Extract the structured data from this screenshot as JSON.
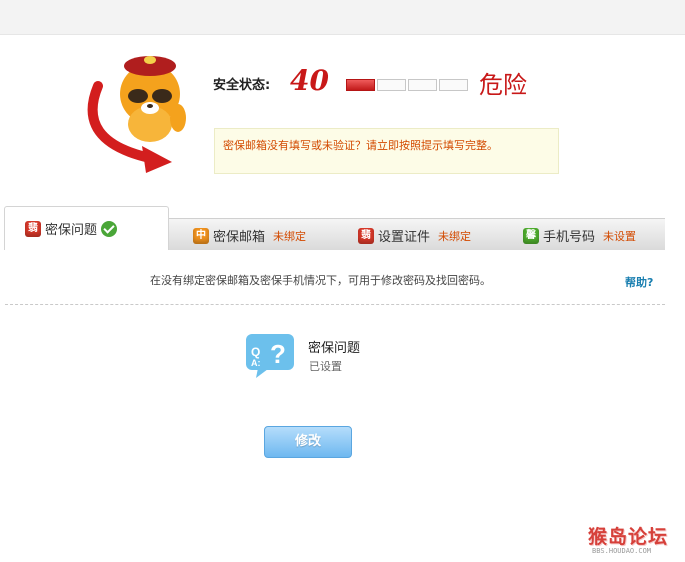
{
  "security": {
    "status_label": "安全状态:",
    "score": "40",
    "score_value": 40,
    "meter_segments_filled": 1,
    "meter_segments_total": 4,
    "level": "危险",
    "notice": "密保邮箱没有填写或未验证？请立即按照提示填写完整。"
  },
  "tabs": [
    {
      "label": "密保问题",
      "status": "",
      "icon": "question-badge-icon",
      "icon_char": "翡",
      "active": true,
      "verified": true
    },
    {
      "label": "密保邮箱",
      "status": "未绑定",
      "icon": "mail-badge-icon",
      "icon_char": "中"
    },
    {
      "label": "设置证件",
      "status": "未绑定",
      "icon": "id-badge-icon",
      "icon_char": "翡"
    },
    {
      "label": "手机号码",
      "status": "未设置",
      "icon": "phone-badge-icon",
      "icon_char": "馨"
    }
  ],
  "panel": {
    "description": "在没有绑定密保邮箱及密保手机情况下，可用于修改密码及找回密码。",
    "help": "帮助?",
    "item_title": "密保问题",
    "item_status": "已设置",
    "item_icon": "qa-bubble-icon",
    "modify_button": "修改"
  },
  "watermark": {
    "main": "猴岛论坛",
    "sub": "BBS.HOUDAO.COM"
  },
  "colors": {
    "danger": "#c81818",
    "warning_text": "#d34a00",
    "link": "#1a7fb0",
    "button": "#6eb8f0"
  }
}
